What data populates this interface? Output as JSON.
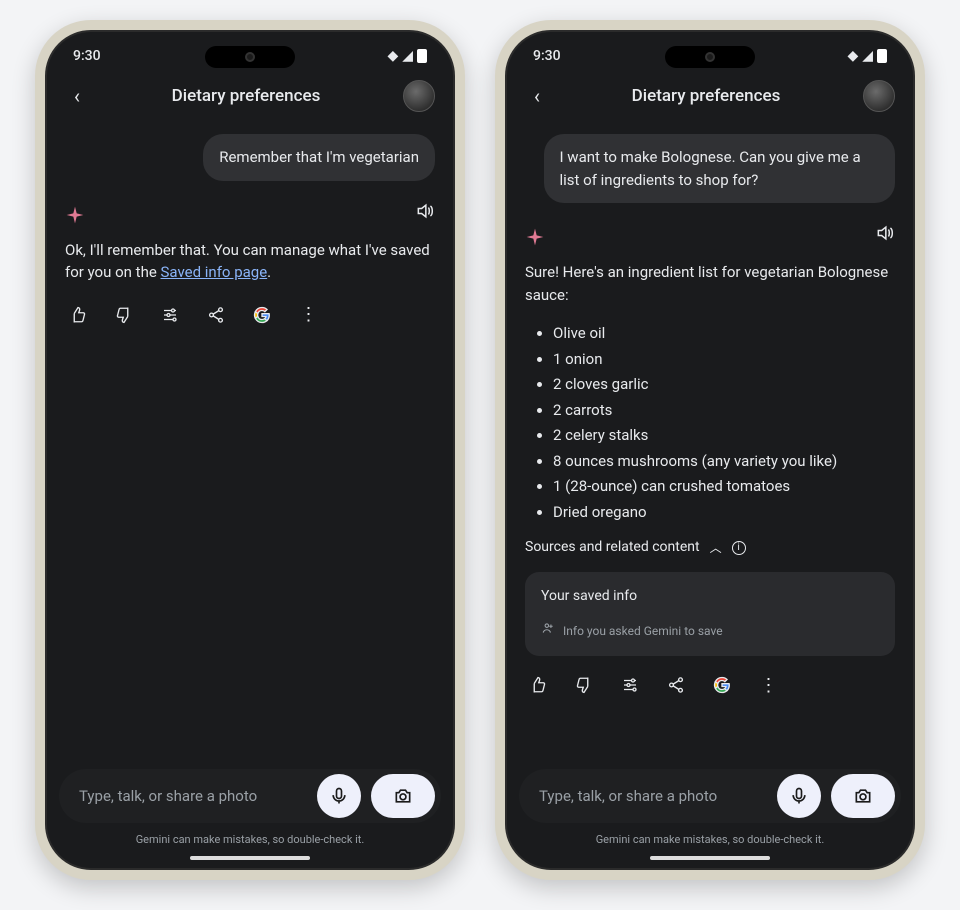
{
  "status": {
    "time": "9:30"
  },
  "header": {
    "title": "Dietary preferences"
  },
  "left": {
    "user_msg": "Remember that I'm vegetarian",
    "assistant_prefix": "Ok, I'll remember that. You can manage what I've saved for you on the ",
    "assistant_link": "Saved info page",
    "assistant_suffix": "."
  },
  "right": {
    "user_msg": "I want to make Bolognese. Can you give me a list of ingredients to shop for?",
    "assistant_intro": "Sure! Here's an ingredient list for vegetarian Bolognese sauce:",
    "ingredients": [
      "Olive oil",
      "1 onion",
      "2 cloves garlic",
      "2 carrots",
      "2 celery stalks",
      "8 ounces mushrooms (any variety you like)",
      "1 (28-ounce) can crushed tomatoes",
      "Dried oregano"
    ],
    "sources_label": "Sources and related content",
    "saved_title": "Your saved info",
    "saved_sub": "Info you asked Gemini to save"
  },
  "input": {
    "placeholder": "Type, talk, or share a photo"
  },
  "footer": {
    "disclaimer": "Gemini can make mistakes, so double-check it."
  }
}
